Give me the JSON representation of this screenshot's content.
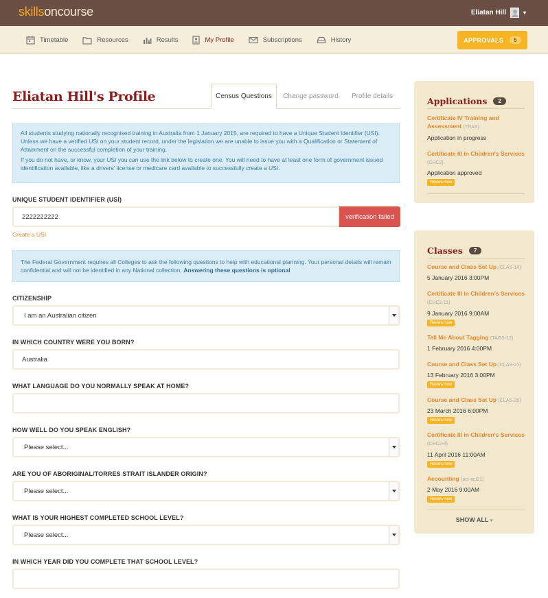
{
  "brand": {
    "part1": "skills",
    "part2": "oncourse"
  },
  "user": {
    "name": "Eliatan Hill",
    "caret": "▾"
  },
  "nav": {
    "items": [
      {
        "label": "Timetable",
        "icon": "timetable-icon"
      },
      {
        "label": "Resources",
        "icon": "folder-icon"
      },
      {
        "label": "Results",
        "icon": "bar-chart-icon"
      },
      {
        "label": "My Profile",
        "icon": "profile-icon"
      },
      {
        "label": "Subscriptions",
        "icon": "envelope-icon"
      },
      {
        "label": "History",
        "icon": "history-icon"
      }
    ],
    "approvals": {
      "label": "APPROVALS",
      "count": "5"
    }
  },
  "page": {
    "title": "Eliatan Hill's Profile",
    "tabs": [
      "Census Questions",
      "Change password",
      "Profile details"
    ]
  },
  "usi_info": {
    "p1": "All students studying nationally recognised training in Australia from 1 January 2015, are required to have a Unique Student Identifier (USI). Unless we have a verified USI on your student record, under the legislation we are unable to issue you with a Qualification or Statement of Attainment on the successful completion of your training.",
    "p2": "If you do not have, or know, your USI you can use the link below to create one. You will need to have at least one form of government issued identification available, like a drivers' license or medicare card available to successfully create a USI."
  },
  "usi": {
    "label": "UNIQUE STUDENT IDENTIFIER (USI)",
    "value": "2222222222",
    "status": "verification failed",
    "create_link": "Create a USI"
  },
  "census_info": {
    "text": "The Federal Government requires all Colleges to ask the following questions to help with educational planning. Your personal details will remain confidential and will not be identified in any National collection.",
    "bold": "Answering these questions is optional"
  },
  "form": {
    "citizenship": {
      "label": "CITIZENSHIP",
      "value": "I am an Australian citizen"
    },
    "country": {
      "label": "IN WHICH COUNTRY WERE YOU BORN?",
      "value": "Australia"
    },
    "language": {
      "label": "WHAT LANGUAGE DO YOU NORMALLY SPEAK AT HOME?",
      "value": ""
    },
    "english": {
      "label": "HOW WELL DO YOU SPEAK ENGLISH?",
      "value": "Please select..."
    },
    "aboriginal": {
      "label": "ARE YOU OF ABORIGINAL/TORRES STRAIT ISLANDER ORIGIN?",
      "value": "Please select..."
    },
    "school": {
      "label": "WHAT IS YOUR HIGHEST COMPLETED SCHOOL LEVEL?",
      "value": "Please select..."
    },
    "school_year": {
      "label": "IN WHICH YEAR DID YOU COMPLETE THAT SCHOOL LEVEL?",
      "value": ""
    }
  },
  "applications": {
    "title": "Applications",
    "count": "2",
    "items": [
      {
        "title": "Certificate IV Training and Assessment",
        "code": "(TRAS)",
        "status": "Application in progress"
      },
      {
        "title": "Certificate III in Children's Services",
        "code": "(CHC2)",
        "status": "Application approved",
        "review": "Review now"
      }
    ]
  },
  "classes": {
    "title": "Classes",
    "count": "7",
    "items": [
      {
        "title": "Course and Class Set Up",
        "code": "(CLAS-14)",
        "date": "5 January 2016 3:00PM"
      },
      {
        "title": "Certificate III in Children's Services",
        "code": "(CHC2-11)",
        "date": "9 January 2016 9:00AM",
        "review": "Review now"
      },
      {
        "title": "Tell Me About Tagging",
        "code": "(TAGS-12)",
        "date": "1 February 2016 4:00PM"
      },
      {
        "title": "Course and Class Set Up",
        "code": "(CLAS-21)",
        "date": "13 February 2016 3:00PM",
        "review": "Review now"
      },
      {
        "title": "Course and Class Set Up",
        "code": "(CLAS-25)",
        "date": "23 March 2016 6:00PM",
        "review": "Review now"
      },
      {
        "title": "Certificate III in Children's Services",
        "code": "(CHC2-8)",
        "date": "11 April 2016 11:00AM",
        "review": "Review now"
      },
      {
        "title": "Accounting",
        "code": "(act-act21)",
        "date": "2 May 2016 9:00AM",
        "review": "Review now"
      }
    ],
    "show_all": "SHOW ALL"
  }
}
